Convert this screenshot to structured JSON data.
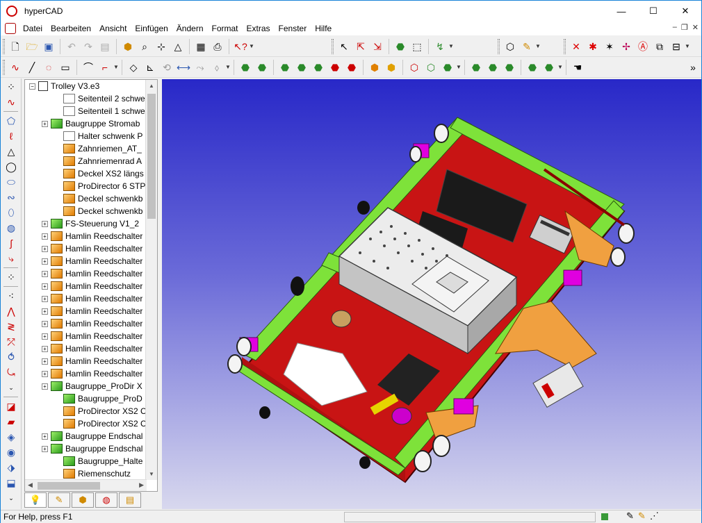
{
  "window": {
    "title": "hyperCAD"
  },
  "titlebar_buttons": {
    "minimize": "—",
    "maximize": "☐",
    "close": "✕"
  },
  "menu": [
    "Datei",
    "Bearbeiten",
    "Ansicht",
    "Einfügen",
    "Ändern",
    "Format",
    "Extras",
    "Fenster",
    "Hilfe"
  ],
  "mdi_buttons": {
    "minimize": "–",
    "restore": "❐",
    "close": "✕"
  },
  "tree": {
    "root": "Trolley V3.e3",
    "items": [
      {
        "label": "Seitenteil 2 schwe",
        "icon": "part-white-icon",
        "indent": 2,
        "expand": false
      },
      {
        "label": "Seitenteil 1 schwe",
        "icon": "part-white-icon",
        "indent": 2,
        "expand": false
      },
      {
        "label": "Baugruppe Stromab",
        "icon": "assembly-green-icon",
        "indent": 1,
        "expand": true
      },
      {
        "label": "Halter schwenk P",
        "icon": "part-white-icon",
        "indent": 2,
        "expand": false
      },
      {
        "label": "Zahnriemen_AT_",
        "icon": "part-orange-icon",
        "indent": 2,
        "expand": false
      },
      {
        "label": "Zahnriemenrad A",
        "icon": "part-orange-icon",
        "indent": 2,
        "expand": false
      },
      {
        "label": "Deckel XS2 längs",
        "icon": "part-orange-icon",
        "indent": 2,
        "expand": false
      },
      {
        "label": "ProDirector 6 STP",
        "icon": "part-orange-icon",
        "indent": 2,
        "expand": false
      },
      {
        "label": "Deckel schwenkb",
        "icon": "part-orange-icon",
        "indent": 2,
        "expand": false
      },
      {
        "label": "Deckel schwenkb",
        "icon": "part-orange-icon",
        "indent": 2,
        "expand": false
      },
      {
        "label": "FS-Steuerung V1_2",
        "icon": "assembly-green-icon",
        "indent": 1,
        "expand": true
      },
      {
        "label": "Hamlin Reedschalter",
        "icon": "part-orange-icon",
        "indent": 1,
        "expand": true
      },
      {
        "label": "Hamlin Reedschalter",
        "icon": "part-orange-icon",
        "indent": 1,
        "expand": true
      },
      {
        "label": "Hamlin Reedschalter",
        "icon": "part-orange-icon",
        "indent": 1,
        "expand": true
      },
      {
        "label": "Hamlin Reedschalter",
        "icon": "part-orange-icon",
        "indent": 1,
        "expand": true
      },
      {
        "label": "Hamlin Reedschalter",
        "icon": "part-orange-icon",
        "indent": 1,
        "expand": true
      },
      {
        "label": "Hamlin Reedschalter",
        "icon": "part-orange-icon",
        "indent": 1,
        "expand": true
      },
      {
        "label": "Hamlin Reedschalter",
        "icon": "part-orange-icon",
        "indent": 1,
        "expand": true
      },
      {
        "label": "Hamlin Reedschalter",
        "icon": "part-orange-icon",
        "indent": 1,
        "expand": true
      },
      {
        "label": "Hamlin Reedschalter",
        "icon": "part-orange-icon",
        "indent": 1,
        "expand": true
      },
      {
        "label": "Hamlin Reedschalter",
        "icon": "part-orange-icon",
        "indent": 1,
        "expand": true
      },
      {
        "label": "Hamlin Reedschalter",
        "icon": "part-orange-icon",
        "indent": 1,
        "expand": true
      },
      {
        "label": "Hamlin Reedschalter",
        "icon": "part-orange-icon",
        "indent": 1,
        "expand": true
      },
      {
        "label": "Baugruppe_ProDir X",
        "icon": "assembly-green-icon",
        "indent": 1,
        "expand": true
      },
      {
        "label": "Baugruppe_ProD",
        "icon": "assembly-green-icon",
        "indent": 2,
        "expand": false
      },
      {
        "label": "ProDirector XS2 C",
        "icon": "part-orange-icon",
        "indent": 2,
        "expand": false
      },
      {
        "label": "ProDirector XS2 C",
        "icon": "part-orange-icon",
        "indent": 2,
        "expand": false
      },
      {
        "label": "Baugruppe Endschal",
        "icon": "assembly-green-icon",
        "indent": 1,
        "expand": true
      },
      {
        "label": "Baugruppe Endschal",
        "icon": "assembly-green-icon",
        "indent": 1,
        "expand": true
      },
      {
        "label": "Baugruppe_Halte",
        "icon": "assembly-green-icon",
        "indent": 2,
        "expand": false
      },
      {
        "label": "Riemenschutz",
        "icon": "part-orange-icon",
        "indent": 2,
        "expand": false
      }
    ]
  },
  "statusbar": {
    "help_text": "For Help, press F1"
  },
  "colors": {
    "frame_green": "#7ee23a",
    "base_red": "#d41a1a",
    "wheel_magenta": "#e000e0",
    "bracket_orange": "#f0a040",
    "viewport_top": "#2828c8",
    "viewport_bottom": "#d8d8ee"
  }
}
